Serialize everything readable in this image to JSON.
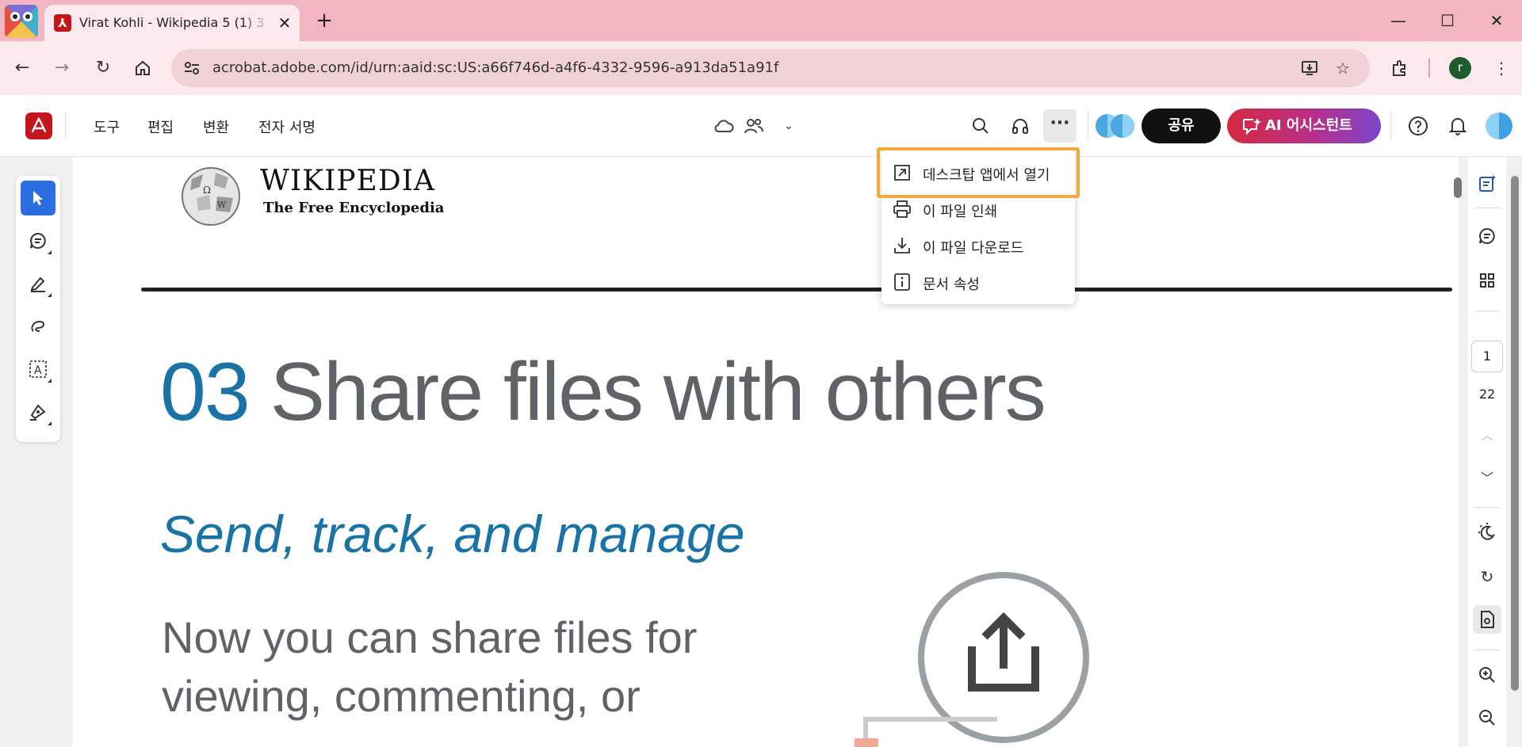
{
  "browser": {
    "tab_title": "Virat Kohli - Wikipedia 5 (1) 3",
    "tab_close": "✕",
    "new_tab": "+",
    "url": "acrobat.adobe.com/id/urn:aaid:sc:US:a66f746d-a4f6-4332-9596-a913da51a91f",
    "user_initial": "r",
    "window_controls": {
      "minimize": "—",
      "maximize": "☐",
      "close": "✕"
    }
  },
  "appbar": {
    "menu": [
      "도구",
      "편집",
      "변환",
      "전자 서명"
    ],
    "share_label": "공유",
    "ai_label": "AI 어시스턴트"
  },
  "dropdown": {
    "items": [
      {
        "label": "데스크탑 앱에서 열기",
        "icon": "open-external-icon"
      },
      {
        "label": "이 파일 인쇄",
        "icon": "printer-icon"
      },
      {
        "label": "이 파일 다운로드",
        "icon": "download-icon"
      },
      {
        "label": "문서 속성",
        "icon": "info-icon"
      }
    ]
  },
  "document": {
    "wiki_title": "WIKIPEDIA",
    "wiki_subtitle": "The Free Encyclopedia",
    "heading_number": "03",
    "heading_text": " Share files with others",
    "subheading": "Send, track, and manage",
    "body_lines": [
      "Now you can share files for",
      "viewing, commenting, or"
    ]
  },
  "pagination": {
    "current": "1",
    "total": "22"
  },
  "colors": {
    "accent_blue": "#1a73a6",
    "highlight_orange": "#f2a93b",
    "acrobat_red": "#c4161c",
    "active_tool": "#2c6de0"
  }
}
